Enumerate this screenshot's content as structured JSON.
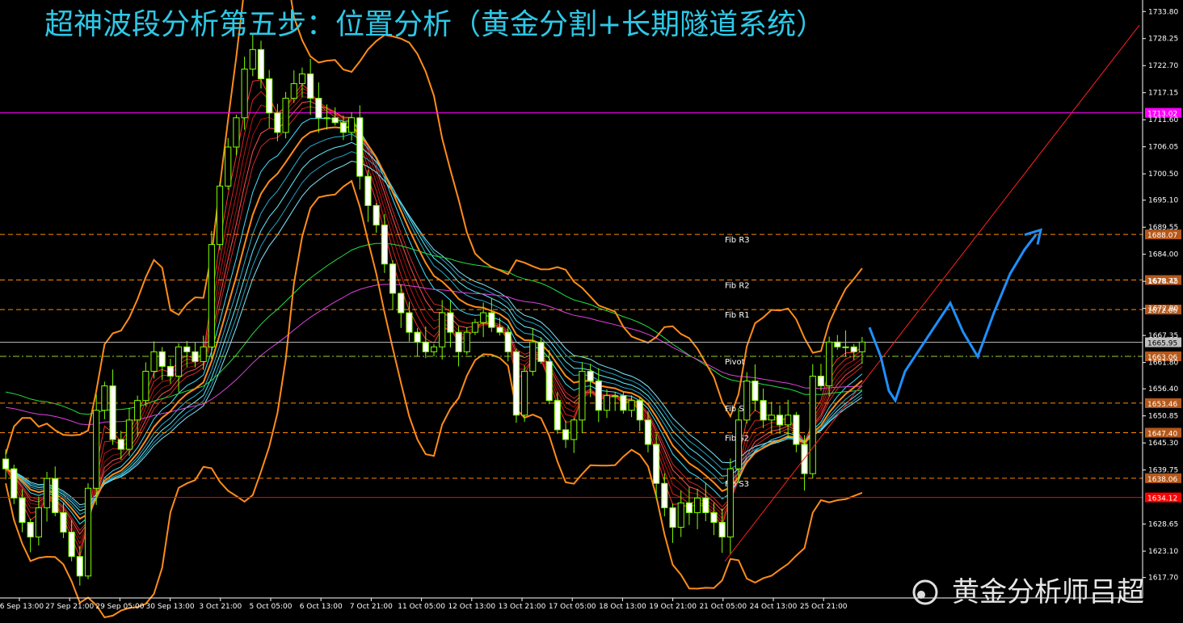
{
  "chart_data": {
    "type": "candlestick",
    "title": "超神波段分析第五步：位置分析（黄金分割+长期隧道系统）",
    "watermark": "黄金分析师吕超",
    "y_axis": {
      "ylim": [
        1613.5,
        1735.5
      ],
      "ticks": [
        "1733.80",
        "1728.25",
        "1722.70",
        "1717.15",
        "1711.60",
        "1706.05",
        "1700.50",
        "1695.10",
        "1689.55",
        "1684.00",
        "1678.45",
        "1672.90",
        "1667.35",
        "1661.80",
        "1656.40",
        "1650.85",
        "1645.30",
        "1639.75",
        "1628.65",
        "1623.10",
        "1617.70"
      ]
    },
    "x_axis": {
      "labels": [
        "26 Sep 13:00",
        "27 Sep 21:00",
        "29 Sep 05:00",
        "30 Sep 13:00",
        "3 Oct 21:00",
        "5 Oct 05:00",
        "6 Oct 13:00",
        "7 Oct 21:00",
        "11 Oct 05:00",
        "12 Oct 13:00",
        "13 Oct 21:00",
        "17 Oct 05:00",
        "18 Oct 13:00",
        "19 Oct 21:00",
        "21 Oct 05:00",
        "24 Oct 13:00",
        "25 Oct 21:00"
      ]
    },
    "price_levels": [
      {
        "name": "",
        "value": "1713.02",
        "color": "#ff00ff",
        "style": "solid"
      },
      {
        "name": "Fib R3",
        "value": "1688.07",
        "color": "#ff8c00",
        "style": "dash"
      },
      {
        "name": "Fib R2",
        "value": "1678.72",
        "color": "#ff8c00",
        "style": "dash"
      },
      {
        "name": "Fib R1",
        "value": "1672.66",
        "color": "#ff8c00",
        "style": "dash"
      },
      {
        "name": "",
        "value": "1665.95",
        "color": "#bfbfbf",
        "style": "solid"
      },
      {
        "name": "Pivot",
        "value": "1663.06",
        "color": "#9acd32",
        "style": "dashdot"
      },
      {
        "name": "Fib S1",
        "value": "1653.46",
        "color": "#ff8c00",
        "style": "dash"
      },
      {
        "name": "Fib S2",
        "value": "1647.40",
        "color": "#ff8c00",
        "style": "dash"
      },
      {
        "name": "Fib S3",
        "value": "1638.06",
        "color": "#ff8c00",
        "style": "dash"
      },
      {
        "name": "",
        "value": "1634.12",
        "color": "#ff0000",
        "style": "solid"
      }
    ],
    "candles_close": [
      1640,
      1634,
      1629,
      1626,
      1632,
      1638,
      1631,
      1627,
      1622,
      1618,
      1636,
      1652,
      1657,
      1646,
      1644,
      1650,
      1654,
      1660,
      1664,
      1661,
      1659,
      1665,
      1664,
      1662,
      1665,
      1686,
      1698,
      1706,
      1712,
      1722,
      1726,
      1720,
      1713,
      1709,
      1716,
      1719,
      1721,
      1716,
      1712,
      1712,
      1711,
      1709,
      1712,
      1700,
      1694,
      1690,
      1682,
      1676,
      1672,
      1668,
      1666,
      1664,
      1665,
      1672,
      1668,
      1664,
      1668,
      1670,
      1672,
      1669,
      1668,
      1664,
      1651,
      1660,
      1666,
      1662,
      1654,
      1648,
      1646,
      1650,
      1660,
      1658,
      1652,
      1655,
      1655,
      1652,
      1654,
      1650,
      1645,
      1637,
      1632,
      1628,
      1633,
      1631,
      1634,
      1631,
      1629,
      1626,
      1640,
      1650,
      1658,
      1654,
      1650,
      1651,
      1649,
      1651,
      1645,
      1639,
      1659,
      1657,
      1666,
      1665,
      1665,
      1664,
      1666
    ]
  }
}
